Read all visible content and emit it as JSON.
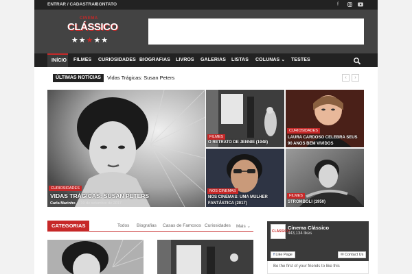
{
  "topbar": {
    "login_label": "ENTRAR / CADASTRAR",
    "contact_label": "CONTATO",
    "social": [
      "facebook-icon",
      "instagram-icon",
      "youtube-icon"
    ]
  },
  "logo": {
    "line1": "CINEMA",
    "line2": "CLÁSSICO",
    "stars": "★★★★"
  },
  "nav": {
    "items": [
      "INÍCIO",
      "FILMES",
      "CURIOSIDADES",
      "BIOGRAFIAS",
      "LIVROS",
      "GALERIAS",
      "LISTAS",
      "COLUNAS",
      "TESTES"
    ],
    "active_index": 0,
    "dropdown_glyph": "⌄"
  },
  "ticker": {
    "label": "ÚLTIMAS NOTÍCIAS",
    "headline": "Vidas Trágicas: Susan Peters",
    "prev": "‹",
    "next": "›"
  },
  "featured": {
    "main": {
      "category": "CURIOSIDADES",
      "title": "VIDAS TRÁGICAS: SUSAN PETERS",
      "author": "Carla Marinho",
      "date": "- 19 de setembro de 2017"
    },
    "tiles": [
      {
        "category": "FILMES",
        "title": "O RETRATO DE JENNIE (1948)"
      },
      {
        "category": "CURIOSIDADES",
        "title": "LAURA CARDOSO CELEBRA SEUS 90 ANOS BEM VIVIDOS"
      },
      {
        "category": "NOS CINEMAS",
        "title": "NOS CINEMAS: UMA MULHER FANTÁSTICA (2017)"
      },
      {
        "category": "FILMES",
        "title": "STROMBOLI (1950)"
      }
    ]
  },
  "categories": {
    "label": "CATEGORIAS",
    "tabs": [
      "Todos",
      "Biografias",
      "Casas de Famosos",
      "Curiosidades",
      "Mais"
    ]
  },
  "facebook": {
    "page_name": "Cinema Clássico",
    "likes": "443,134 likes",
    "like_button": "Like Page",
    "contact_button": "Contact Us",
    "friends_text": "Be the first of your friends to like this"
  },
  "colors": {
    "accent": "#c62828",
    "dark": "#222222",
    "header": "#434343"
  }
}
